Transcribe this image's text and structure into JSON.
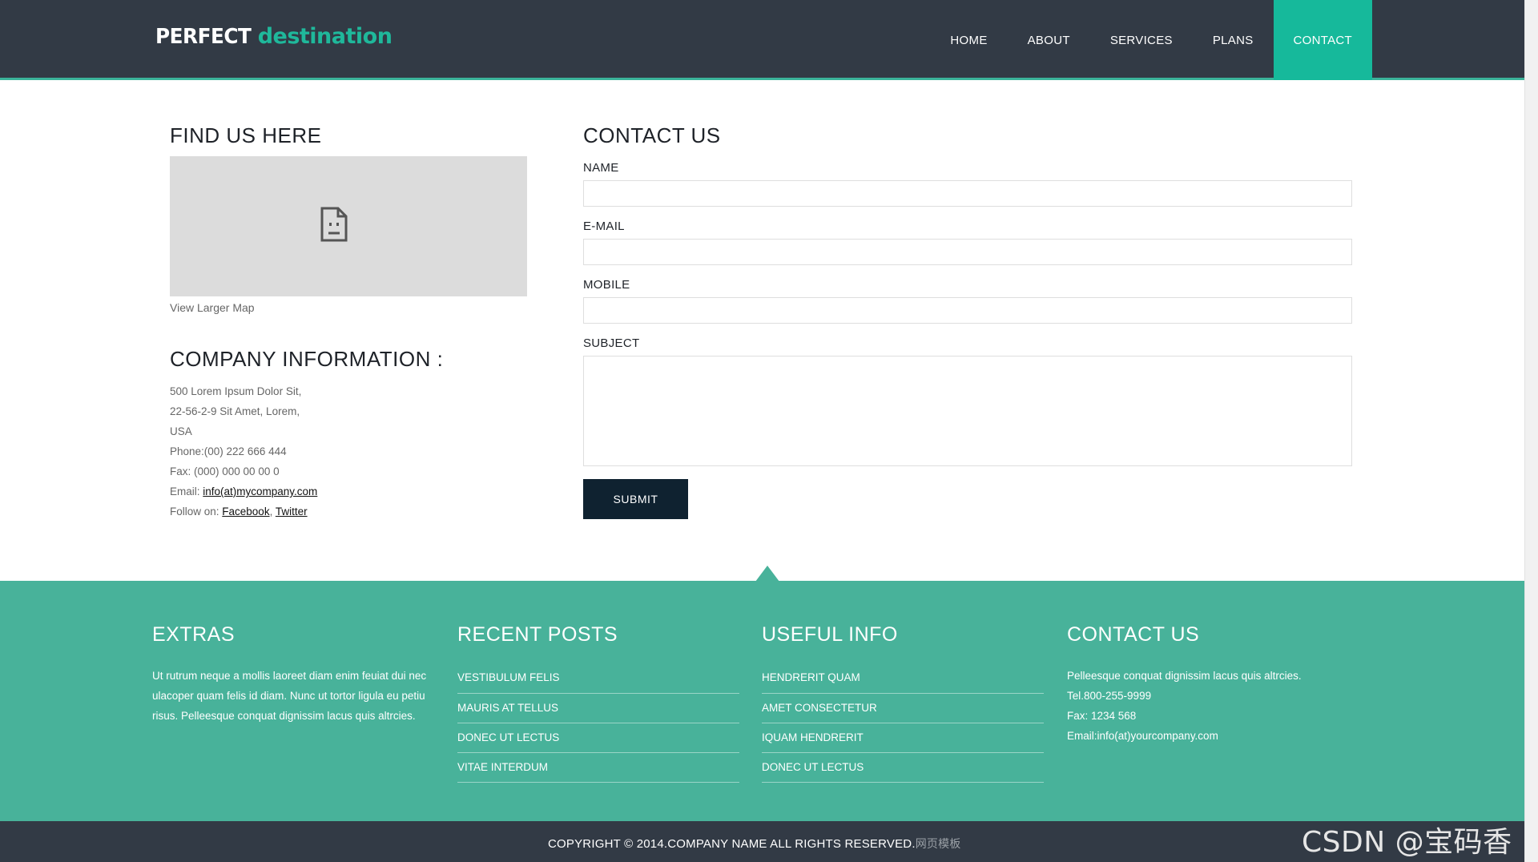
{
  "header": {
    "logo_part1": "PERFECT",
    "logo_part2": "destination",
    "nav": [
      {
        "label": "HOME"
      },
      {
        "label": "ABOUT"
      },
      {
        "label": "SERVICES"
      },
      {
        "label": "PLANS"
      },
      {
        "label": "CONTACT"
      }
    ],
    "active": "CONTACT"
  },
  "find_us": {
    "title": "FIND US HERE",
    "map_link": "View Larger Map"
  },
  "company": {
    "title": "COMPANY INFORMATION :",
    "address1": "500 Lorem Ipsum Dolor Sit,",
    "address2": "22-56-2-9 Sit Amet, Lorem,",
    "address3": "USA",
    "phone": "Phone:(00) 222 666 444",
    "fax": "Fax: (000) 000 00 00 0",
    "email_label": "Email: ",
    "email_link": "info(at)mycompany.com",
    "follow_label": "Follow on: ",
    "follow_facebook": "Facebook",
    "follow_sep": ", ",
    "follow_twitter": "Twitter"
  },
  "contact_form": {
    "title": "CONTACT US",
    "name_label": "NAME",
    "email_label": "E-MAIL",
    "mobile_label": "MOBILE",
    "subject_label": "SUBJECT",
    "name_value": "",
    "email_value": "",
    "mobile_value": "",
    "subject_value": "",
    "submit_label": "SUBMIT"
  },
  "footer": {
    "extras": {
      "title": "EXTRAS",
      "text": "Ut rutrum neque a mollis laoreet diam enim feuiat dui nec ulacoper quam felis id diam. Nunc ut tortor ligula eu petiu risus. Pelleesque conquat dignissim lacus quis altrcies."
    },
    "recent_posts": {
      "title": "RECENT POSTS",
      "items": [
        "VESTIBULUM FELIS",
        "MAURIS AT TELLUS",
        "DONEC UT LECTUS",
        "VITAE INTERDUM"
      ]
    },
    "useful_info": {
      "title": "USEFUL INFO",
      "items": [
        "HENDRERIT QUAM",
        "AMET CONSECTETUR",
        "IQUAM HENDRERIT",
        "DONEC UT LECTUS"
      ]
    },
    "contact": {
      "title": "CONTACT US",
      "line1": "Pelleesque conquat dignissim lacus quis altrcies.",
      "line2": "Tel.800-255-9999",
      "line3": "Fax: 1234 568",
      "line4": "Email:info(at)yourcompany.com"
    }
  },
  "bottom": {
    "copyright": "COPYRIGHT © 2014.COMPANY NAME ALL RIGHTS RESERVED.",
    "extra": "网页模板"
  },
  "watermark": "CSDN @宝码香车",
  "colors": {
    "header_bg": "#323a45",
    "accent": "#16b99b",
    "footer_bg": "#48b29a",
    "submit_bg": "#0f2230"
  }
}
